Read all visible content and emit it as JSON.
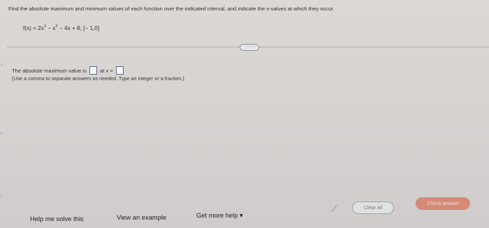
{
  "question": {
    "prompt": "Find the absolute maximum and minimum values of each function over the indicated interval, and indicate the x-values at which they occur.",
    "function_lhs": "f(x) = 2x",
    "exp1": "3",
    "function_mid": " − x",
    "exp2": "2",
    "function_rhs": " − 4x + 8; [− 1,0]"
  },
  "more_indicator": "·····",
  "answer": {
    "prefix": "The absolute maximum value is",
    "middle": "at x =",
    "hint": "(Use a comma to separate answers as needed. Type an integer or a fraction.)"
  },
  "side_arrows": [
    "›",
    "›",
    "›"
  ],
  "bottom": {
    "help_label": "Help me solve this",
    "example_label": "View an example",
    "more_help_label": "Get more help ▾",
    "clear_label": "Clear all",
    "check_label": "Check answer"
  }
}
